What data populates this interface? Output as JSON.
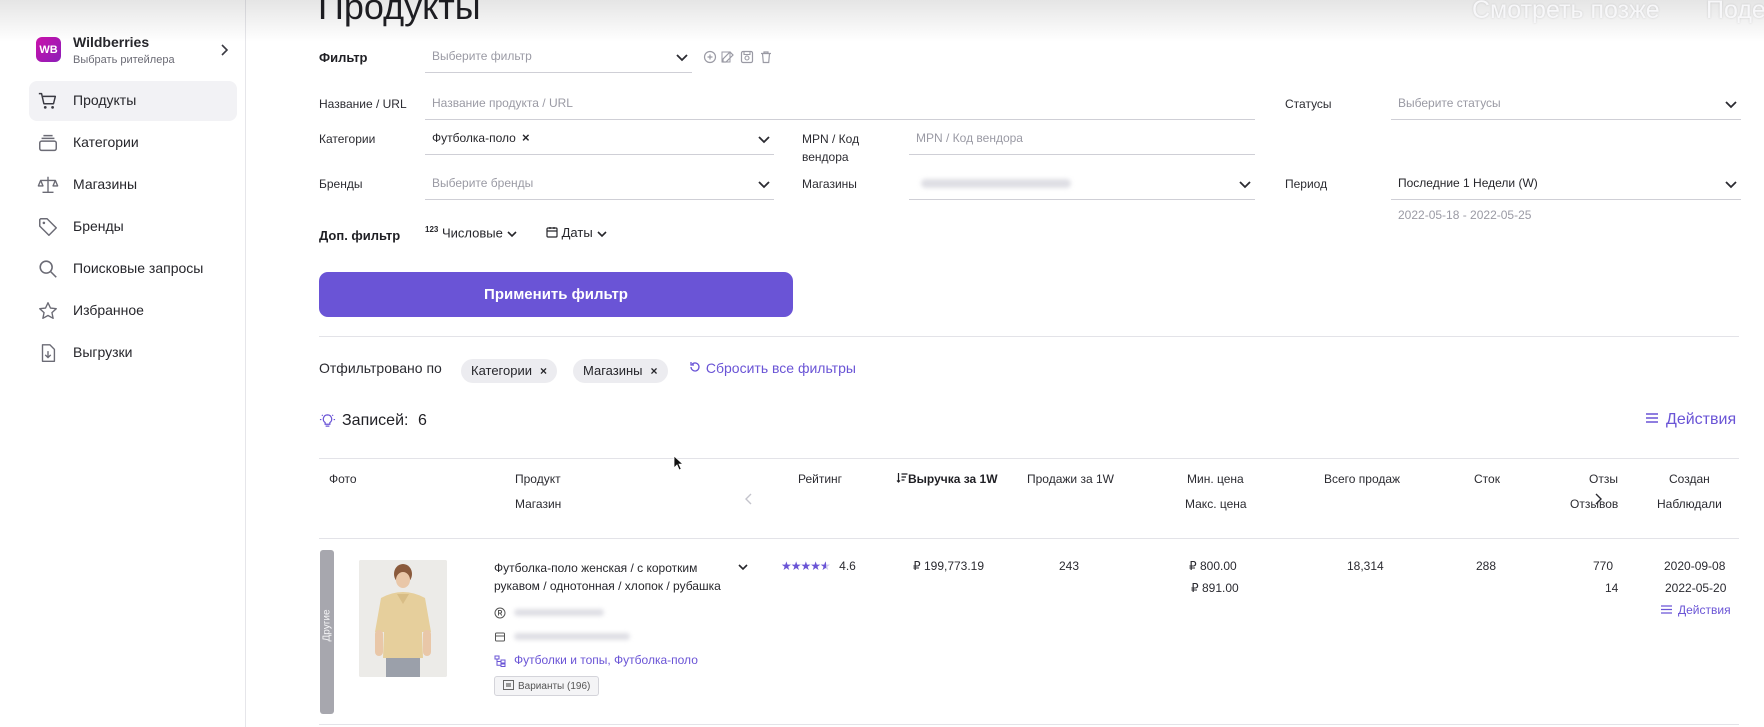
{
  "page": {
    "title": "Продукты"
  },
  "overlay": {
    "watch_later": "Смотреть позже",
    "share": "Подел"
  },
  "sidebar": {
    "retailer": {
      "logo": "WB",
      "name": "Wildberries",
      "sub": "Выбрать ритейлера"
    },
    "items": [
      {
        "label": "Продукты",
        "icon": "cart-icon",
        "active": true
      },
      {
        "label": "Категории",
        "icon": "stack-icon"
      },
      {
        "label": "Магазины",
        "icon": "scales-icon"
      },
      {
        "label": "Бренды",
        "icon": "tag-icon"
      },
      {
        "label": "Поисковые запросы",
        "icon": "search-icon"
      },
      {
        "label": "Избранное",
        "icon": "star-icon"
      },
      {
        "label": "Выгрузки",
        "icon": "download-file-icon"
      }
    ]
  },
  "filter": {
    "label": "Фильтр",
    "placeholder": "Выберите фильтр",
    "name_label": "Название / URL",
    "name_placeholder": "Название продукта / URL",
    "statuses_label": "Статусы",
    "statuses_placeholder": "Выберите статусы",
    "categories_label": "Категории",
    "categories_value": "Футболка-поло",
    "mpn_label_1": "MPN / Код",
    "mpn_label_2": "вендора",
    "mpn_placeholder": "MPN / Код вендора",
    "brands_label": "Бренды",
    "brands_placeholder": "Выберите бренды",
    "shops_label": "Магазины",
    "period_label": "Период",
    "period_value": "Последние 1 Недели (W)",
    "period_range": "2022-05-18 - 2022-05-25",
    "extra_label": "Доп. фильтр",
    "numeric_prefix": "123",
    "numeric_label": "Числовые",
    "dates_label": "Даты",
    "apply_label": "Применить фильтр"
  },
  "applied": {
    "label": "Отфильтровано по",
    "chips": [
      "Категории",
      "Магазины"
    ],
    "reset_label": "Сбросить все фильтры"
  },
  "records": {
    "label": "Записей:",
    "count": "6",
    "actions_label": "Действия"
  },
  "table": {
    "headers": {
      "photo": "Фото",
      "product": "Продукт",
      "shop": "Магазин",
      "rating": "Рейтинг",
      "revenue": "Выручка за 1W",
      "sales": "Продажи за 1W",
      "min_price": "Мин. цена",
      "max_price": "Макс. цена",
      "total_sales": "Всего продаж",
      "stock": "Сток",
      "reviews_top": "Отзы",
      "reviews_bottom": "Отзывов",
      "created": "Создан",
      "observed": "Наблюдали"
    },
    "rows": [
      {
        "side_tag": "Другие",
        "name_line1": "Футболка-поло женская / с коротким",
        "name_line2": "рукавом / однотонная / хлопок / рубашка",
        "categories": "Футболки и топы, Футболка-поло",
        "variants": "Варианты (196)",
        "rating": "4.6",
        "rating_stars": 4.6,
        "revenue": "₽ 199,773.19",
        "sales": "243",
        "min_price": "₽ 800.00",
        "max_price": "₽ 891.00",
        "total_sales": "18,314",
        "stock": "288",
        "reviews": "770",
        "reviews_new": "14",
        "created": "2020-09-08",
        "observed": "2022-05-20",
        "actions": "Действия"
      }
    ]
  },
  "colors": {
    "accent": "#6a54d6",
    "wb_gradient_start": "#cb11ab",
    "wb_gradient_end": "#8b1db8"
  }
}
